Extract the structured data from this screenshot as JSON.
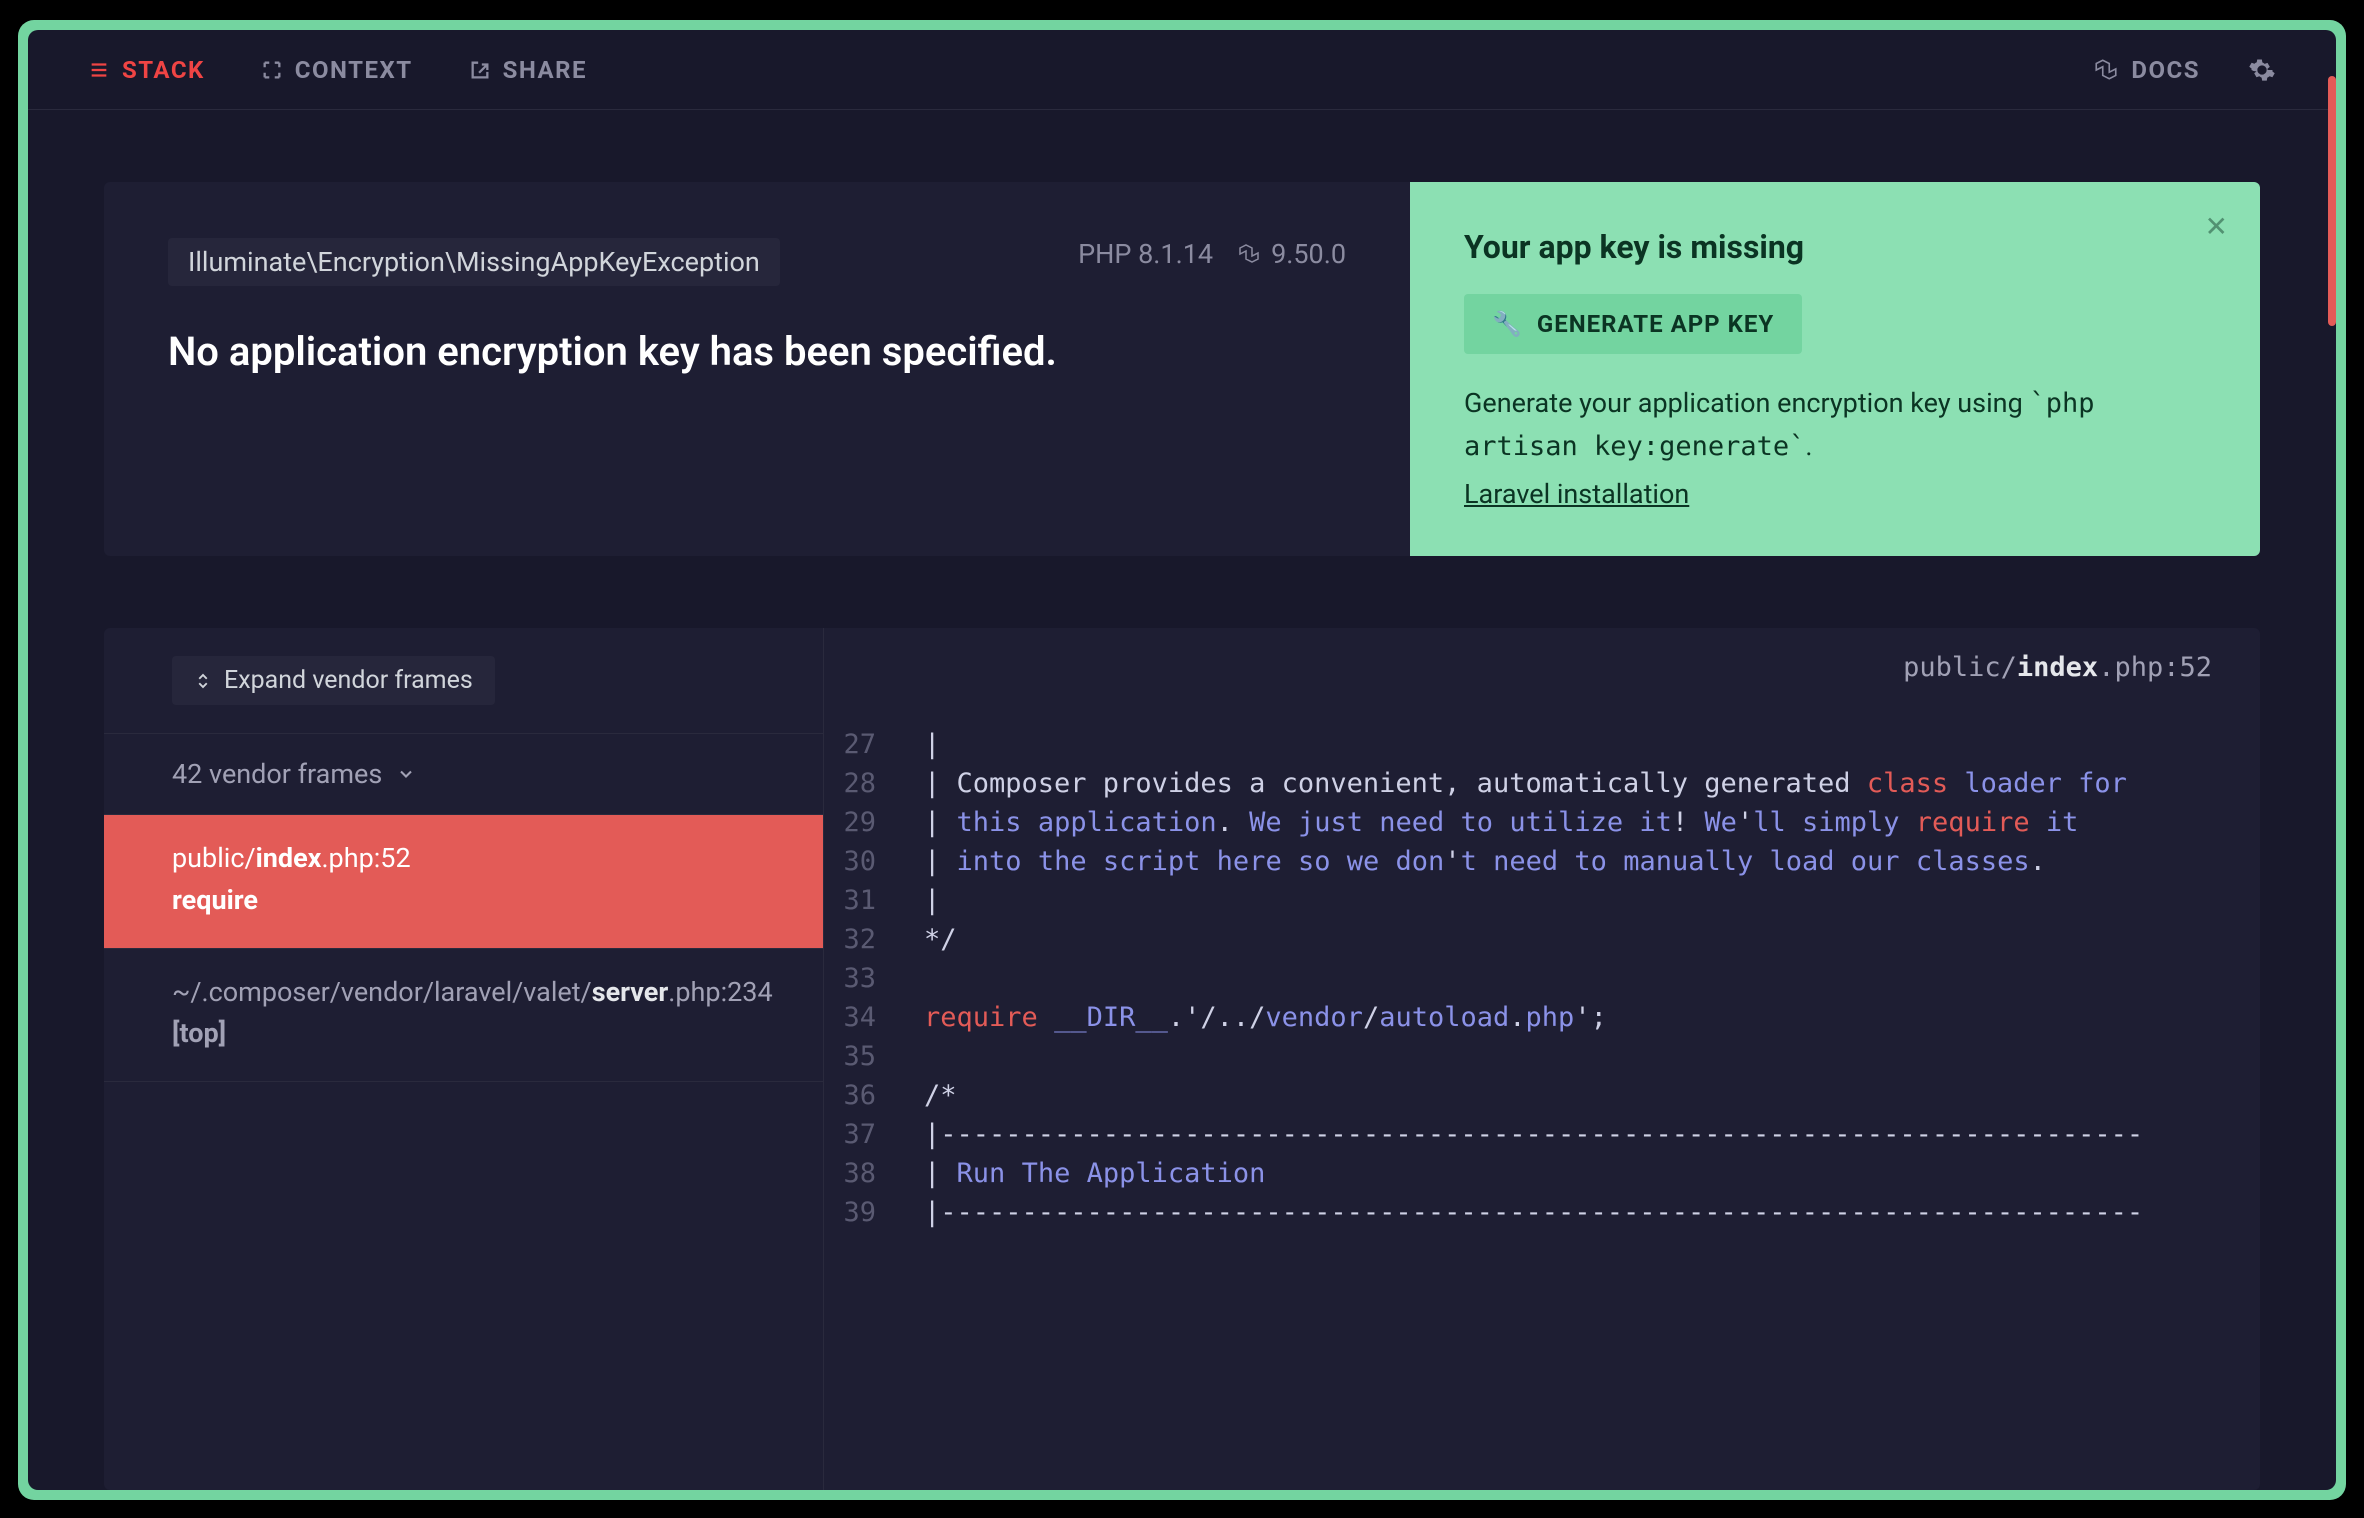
{
  "topbar": {
    "stack": "STACK",
    "context": "CONTEXT",
    "share": "SHARE",
    "docs": "DOCS"
  },
  "header": {
    "exception": "Illuminate\\Encryption\\MissingAppKeyException",
    "php_label": "PHP 8.1.14",
    "laravel_version": "9.50.0",
    "title": "No application encryption key has been specified."
  },
  "solution": {
    "title": "Your app key is missing",
    "button": "GENERATE APP KEY",
    "desc_pre": "Generate your application encryption key using ",
    "desc_code": "`php artisan key:generate`",
    "desc_post": ".",
    "link": "Laravel installation"
  },
  "sidebar": {
    "expand": "Expand vendor frames",
    "vendor_collapse": "42 vendor frames",
    "frames": [
      {
        "path_pre": "public/",
        "path_bold": "index",
        "path_post": ".php",
        "line": ":52",
        "fn": "require"
      },
      {
        "path_pre": "~/.composer/vendor/laravel/valet/",
        "path_bold": "server",
        "path_post": ".php",
        "line": ":234",
        "fn": "[top]"
      }
    ]
  },
  "code": {
    "file_pre": "public/",
    "file_bold": "index",
    "file_post": ".php",
    "file_line": ":52",
    "lines": [
      {
        "n": 27,
        "segs": [
          [
            "dim",
            "|"
          ]
        ]
      },
      {
        "n": 28,
        "segs": [
          [
            "dim",
            "| Composer provides a convenient, automatically generated "
          ],
          [
            "key",
            "class"
          ],
          [
            "dim",
            " "
          ],
          [
            "str",
            "loader"
          ],
          [
            "dim",
            " "
          ],
          [
            "str",
            "for"
          ]
        ]
      },
      {
        "n": 29,
        "segs": [
          [
            "dim",
            "| "
          ],
          [
            "str",
            "this"
          ],
          [
            "dim",
            " "
          ],
          [
            "str",
            "application"
          ],
          [
            "pun",
            "."
          ],
          [
            "dim",
            " "
          ],
          [
            "str",
            "We"
          ],
          [
            "dim",
            " "
          ],
          [
            "str",
            "just"
          ],
          [
            "dim",
            " "
          ],
          [
            "str",
            "need"
          ],
          [
            "dim",
            " "
          ],
          [
            "str",
            "to"
          ],
          [
            "dim",
            " "
          ],
          [
            "str",
            "utilize"
          ],
          [
            "dim",
            " "
          ],
          [
            "str",
            "it"
          ],
          [
            "pun",
            "!"
          ],
          [
            "dim",
            " "
          ],
          [
            "str",
            "We"
          ],
          [
            "pun",
            "'"
          ],
          [
            "str",
            "ll"
          ],
          [
            "dim",
            " "
          ],
          [
            "str",
            "simply"
          ],
          [
            "dim",
            " "
          ],
          [
            "key",
            "require"
          ],
          [
            "dim",
            " "
          ],
          [
            "str",
            "it"
          ]
        ]
      },
      {
        "n": 30,
        "segs": [
          [
            "dim",
            "| "
          ],
          [
            "str",
            "into"
          ],
          [
            "dim",
            " "
          ],
          [
            "str",
            "the"
          ],
          [
            "dim",
            " "
          ],
          [
            "str",
            "script"
          ],
          [
            "dim",
            " "
          ],
          [
            "str",
            "here"
          ],
          [
            "dim",
            " "
          ],
          [
            "str",
            "so"
          ],
          [
            "dim",
            " "
          ],
          [
            "str",
            "we"
          ],
          [
            "dim",
            " "
          ],
          [
            "str",
            "don"
          ],
          [
            "pun",
            "'"
          ],
          [
            "str",
            "t"
          ],
          [
            "dim",
            " "
          ],
          [
            "str",
            "need"
          ],
          [
            "dim",
            " "
          ],
          [
            "str",
            "to"
          ],
          [
            "dim",
            " "
          ],
          [
            "str",
            "manually"
          ],
          [
            "dim",
            " "
          ],
          [
            "str",
            "load"
          ],
          [
            "dim",
            " "
          ],
          [
            "str",
            "our"
          ],
          [
            "dim",
            " "
          ],
          [
            "str",
            "classes"
          ],
          [
            "pun",
            "."
          ]
        ]
      },
      {
        "n": 31,
        "segs": [
          [
            "dim",
            "|"
          ]
        ]
      },
      {
        "n": 32,
        "segs": [
          [
            "dim",
            "*/"
          ]
        ]
      },
      {
        "n": 33,
        "segs": [
          [
            "dim",
            ""
          ]
        ]
      },
      {
        "n": 34,
        "segs": [
          [
            "key",
            "require"
          ],
          [
            "dim",
            " "
          ],
          [
            "str",
            "__DIR__"
          ],
          [
            "pun",
            ".'"
          ],
          [
            "dim",
            "/../"
          ],
          [
            "str",
            "vendor"
          ],
          [
            "dim",
            "/"
          ],
          [
            "str",
            "autoload"
          ],
          [
            "pun",
            "."
          ],
          [
            "str",
            "php"
          ],
          [
            "pun",
            "';"
          ]
        ]
      },
      {
        "n": 35,
        "segs": [
          [
            "dim",
            ""
          ]
        ]
      },
      {
        "n": 36,
        "segs": [
          [
            "dim",
            "/*"
          ]
        ]
      },
      {
        "n": 37,
        "segs": [
          [
            "dim",
            "|--------------------------------------------------------------------------"
          ]
        ]
      },
      {
        "n": 38,
        "segs": [
          [
            "dim",
            "| "
          ],
          [
            "str",
            "Run"
          ],
          [
            "dim",
            " "
          ],
          [
            "str",
            "The"
          ],
          [
            "dim",
            " "
          ],
          [
            "str",
            "Application"
          ]
        ]
      },
      {
        "n": 39,
        "segs": [
          [
            "dim",
            "|--------------------------------------------------------------------------"
          ]
        ]
      }
    ]
  }
}
